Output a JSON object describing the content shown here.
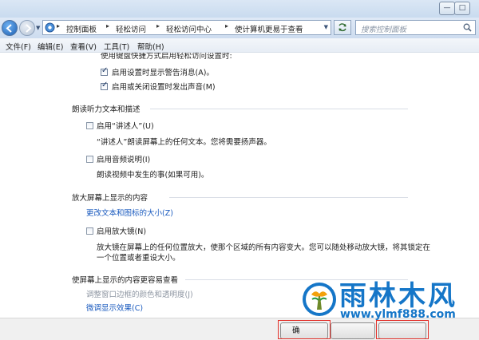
{
  "window": {
    "minimize_glyph": "—",
    "maximize_glyph": "□"
  },
  "address": {
    "breadcrumbs": [
      "控制面板",
      "轻松访问",
      "轻松访问中心",
      "使计算机更易于查看"
    ],
    "separator": "▸",
    "search_placeholder": "搜索控制面板"
  },
  "menu": {
    "items": [
      "文件(F)",
      "编辑(E)",
      "查看(V)",
      "工具(T)",
      "帮助(H)"
    ]
  },
  "content": {
    "intro_partial": "使用键盘快捷方式启用轻松访问设置时:",
    "shortcut_options": [
      {
        "label": "启用设置时显示警告消息(A)。",
        "checked": true
      },
      {
        "label": "启用或关闭设置时发出声音(M)",
        "checked": true
      }
    ],
    "narration_group": {
      "title": "朗读听力文本和描述",
      "narrator": {
        "label": "启用“讲述人”(U)",
        "checked": false,
        "description": "“讲述人”朗读屏幕上的任何文本。您将需要扬声器。"
      },
      "audio_description": {
        "label": "启用音频说明(I)",
        "checked": false,
        "description": "朗读视频中发生的事(如果可用)。"
      }
    },
    "magnify_group": {
      "title": "放大屏幕上显示的内容",
      "link": "更改文本和图标的大小(Z)",
      "magnifier": {
        "label": "启用放大镜(N)",
        "checked": false,
        "description_line1": "放大镜在屏幕上的任何位置放大，使那个区域的所有内容变大。您可以随处移动放大镜，将其锁定在",
        "description_line2": "一个位置或者重设大小。"
      }
    },
    "readable_group": {
      "title": "使屏幕上显示的内容更容易查看",
      "link_disabled": "调整窗口边框的颜色和透明度(J)",
      "link": "微调显示效果(C)"
    }
  },
  "buttons": {
    "ok_partial": "确"
  },
  "watermark": {
    "title": "雨林木风",
    "url": "www.ylmf888.com",
    "brand_color": "#1576c8"
  },
  "colors": {
    "link": "#1b5bbf",
    "highlight_frame": "#e2302a"
  }
}
